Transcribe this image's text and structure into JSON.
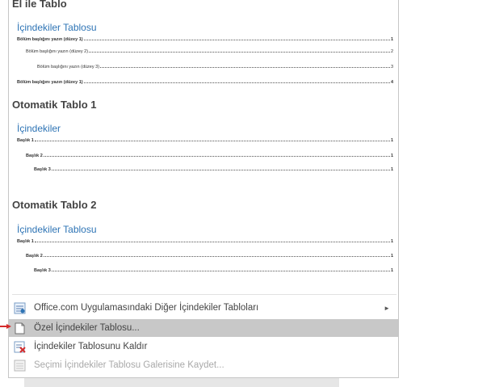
{
  "gallery": {
    "manual": {
      "section_title": "El ile Tablo",
      "toc_heading": "İçindekiler Tablosu",
      "entries": [
        {
          "text": "Bölüm başlığını yazın (düzey 1)",
          "page": "1"
        },
        {
          "text": "Bölüm başlığını yazın (düzey 2)",
          "page": "2"
        },
        {
          "text": "Bölüm başlığını yazın (düzey 3)",
          "page": "3"
        },
        {
          "text": "Bölüm başlığını yazın (düzey 1)",
          "page": "4"
        }
      ]
    },
    "auto1": {
      "section_title": "Otomatik Tablo 1",
      "toc_heading": "İçindekiler",
      "entries": [
        {
          "text": "Başlık 1",
          "page": "1"
        },
        {
          "text": "Başlık 2",
          "page": "1"
        },
        {
          "text": "Başlık 3",
          "page": "1"
        }
      ]
    },
    "auto2": {
      "section_title": "Otomatik Tablo 2",
      "toc_heading": "İçindekiler Tablosu",
      "entries": [
        {
          "text": "Başlık 1",
          "page": "1"
        },
        {
          "text": "Başlık 2",
          "page": "1"
        },
        {
          "text": "Başlık 3",
          "page": "1"
        }
      ]
    }
  },
  "menu": {
    "more_tables": "Office.com Uygulamasındaki Diğer İçindekiler Tabloları",
    "custom_toc": "Özel İçindekiler Tablosu...",
    "remove_toc": "İçindekiler Tablosunu Kaldır",
    "save_selection": "Seçimi İçindekiler Tablosu Galerisine Kaydet..."
  },
  "colors": {
    "toc_heading": "#2e74b5",
    "highlight": "#c8c8c8",
    "pointer_arrow": "#d42b2b"
  }
}
